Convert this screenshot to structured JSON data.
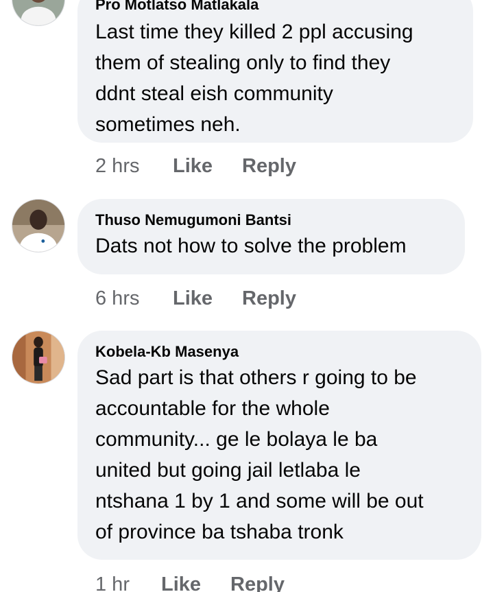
{
  "comments": [
    {
      "author": "Pro Motlatso Matlakala",
      "text": "Last time they killed 2 ppl accusing\nthem of stealing only to find they\nddnt steal eish community\nsometimes neh.",
      "time": "2 hrs",
      "like_label": "Like",
      "reply_label": "Reply",
      "avatar_icon": "user-avatar-icon"
    },
    {
      "author": "Thuso Nemugumoni Bantsi",
      "text": "Dats not how to solve the problem",
      "time": "6 hrs",
      "like_label": "Like",
      "reply_label": "Reply",
      "avatar_icon": "user-avatar-icon"
    },
    {
      "author": "Kobela-Kb Masenya",
      "text": "Sad part is that others r going to be\naccountable for the whole\ncommunity... ge le bolaya le ba\nunited but going jail letlaba le\nntshana 1 by 1 and some will be out\nof province ba tshaba tronk",
      "time": "1 hr",
      "like_label": "Like",
      "reply_label": "Reply",
      "avatar_icon": "user-avatar-icon"
    }
  ],
  "colors": {
    "bubble_bg": "#f0f2f5",
    "meta_text": "#65676b",
    "body_text": "#050505"
  }
}
